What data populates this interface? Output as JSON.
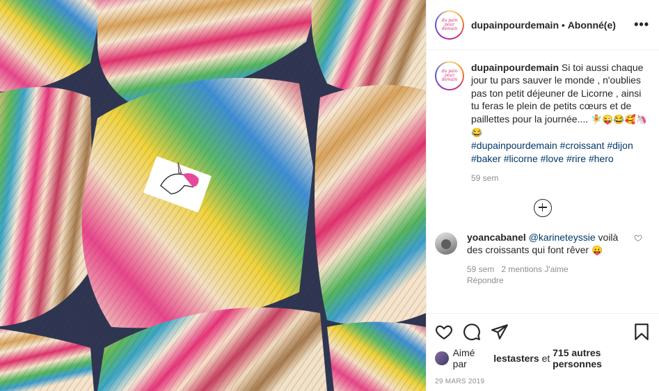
{
  "post": {
    "username": "dupainpourdemain",
    "separator": " • ",
    "follow_status": "Abonné(e)",
    "avatar_text": "du pain pour demain",
    "more_label": "•••"
  },
  "caption": {
    "username": "dupainpourdemain",
    "text": " Si toi aussi chaque jour tu pars sauver le monde , n'oublies pas ton petit déjeuner de Licorne , ainsi tu feras le plein de petits cœurs et de paillettes pour la journée.... ",
    "emojis": "🧚😜😂🥰🦄😂",
    "hashtags": [
      "#dupainpourdemain",
      "#croissant",
      "#dijon",
      "#baker",
      "#licorne",
      "#love",
      "#rire",
      "#hero"
    ],
    "age": "59 sem"
  },
  "comment": {
    "username": "yoancabanel",
    "mention": "@karineteyssie",
    "text": " voilà des croissants qui font rêver ",
    "emoji": "😛",
    "age": "59 sem",
    "likes": "2 mentions J'aime",
    "reply_label": "Répondre"
  },
  "likes": {
    "prefix": "Aimé par ",
    "user": "lestasters",
    "middle": " et ",
    "others": "715 autres personnes"
  },
  "date": "29 MARS 2019",
  "icons": {
    "like": "heart-icon",
    "comment": "comment-icon",
    "share": "paper-plane-icon",
    "save": "bookmark-icon",
    "load_more": "plus-circle-icon",
    "comment_like": "heart-icon"
  },
  "colors": {
    "link": "#00376b",
    "muted": "#8e8e8e",
    "text": "#262626",
    "border": "#efefef"
  }
}
